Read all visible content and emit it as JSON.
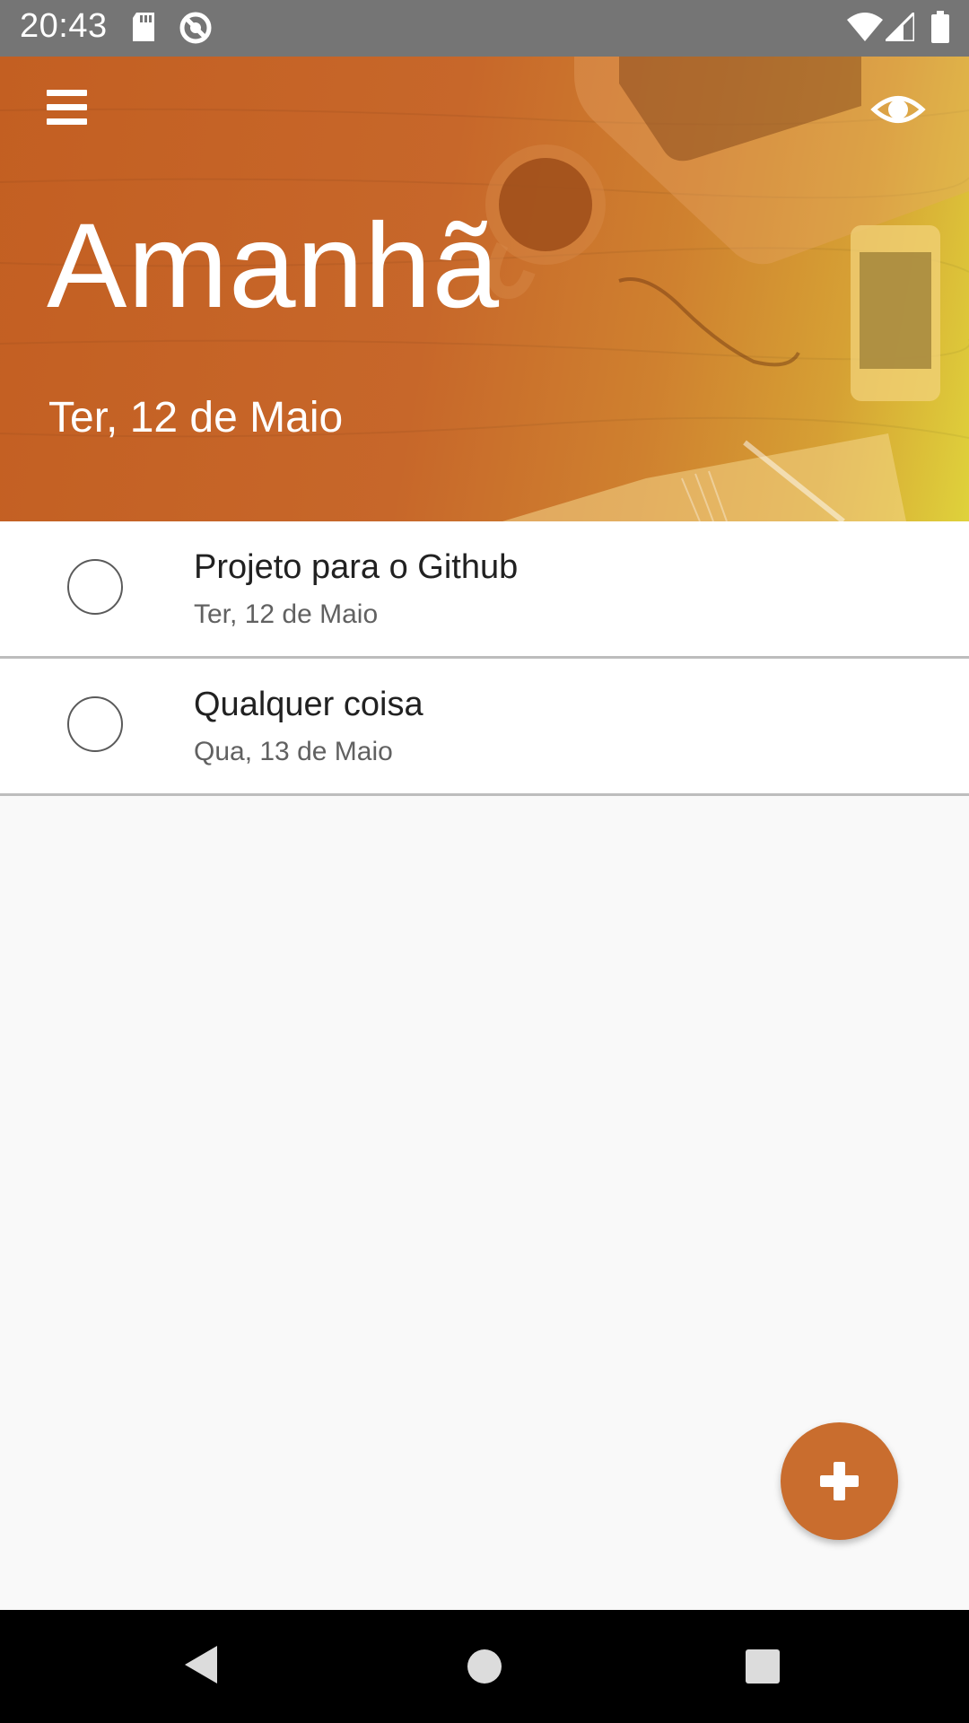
{
  "status_bar": {
    "time": "20:43",
    "icons_left": [
      "sd-card-icon",
      "sync-disabled-icon"
    ],
    "icons_right": [
      "wifi-icon",
      "signal-icon",
      "battery-icon"
    ]
  },
  "header": {
    "title": "Amanhã",
    "subtitle": "Ter, 12 de Maio",
    "menu_icon": "menu-icon",
    "visibility_icon": "eye-icon",
    "gradient_colors": [
      "#c35f22",
      "#cf812f",
      "#dfd23b"
    ]
  },
  "tasks": [
    {
      "title": "Projeto para o Github",
      "date": "Ter, 12 de Maio",
      "done": false
    },
    {
      "title": "Qualquer coisa",
      "date": "Qua, 13 de Maio",
      "done": false
    }
  ],
  "fab": {
    "icon": "plus-icon",
    "color": "#c96d2e"
  },
  "nav_bar": {
    "icons": [
      "back-icon",
      "home-icon",
      "recents-icon"
    ]
  }
}
